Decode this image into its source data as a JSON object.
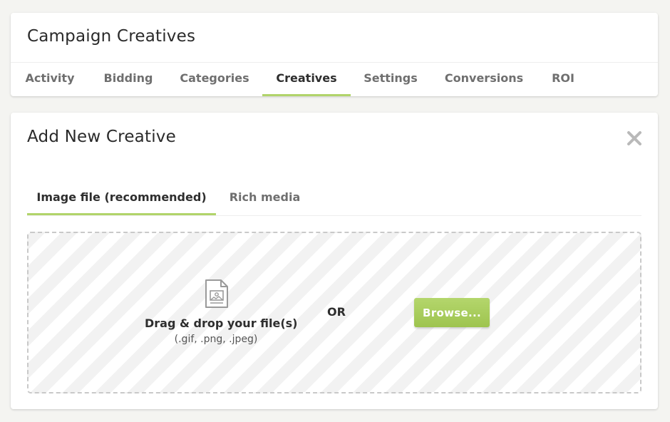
{
  "header": {
    "title": "Campaign Creatives",
    "tabs": [
      {
        "label": "Activity",
        "active": false
      },
      {
        "label": "Bidding",
        "active": false
      },
      {
        "label": "Categories",
        "active": false
      },
      {
        "label": "Creatives",
        "active": true
      },
      {
        "label": "Settings",
        "active": false
      },
      {
        "label": "Conversions",
        "active": false
      },
      {
        "label": "ROI",
        "active": false
      }
    ]
  },
  "creative_panel": {
    "title": "Add New Creative",
    "close_icon": "close-icon",
    "tabs": [
      {
        "label": "Image file (recommended)",
        "active": true
      },
      {
        "label": "Rich media",
        "active": false
      }
    ],
    "dropzone": {
      "icon": "image-file-icon",
      "drag_text": "Drag & drop your file(s)",
      "extensions": "(.gif, .png, .jpeg)",
      "or_text": "OR",
      "browse_label": "Browse..."
    }
  },
  "colors": {
    "accent": "#b1d46a",
    "button": "#a6cb5a",
    "background": "#f4f4f1"
  }
}
